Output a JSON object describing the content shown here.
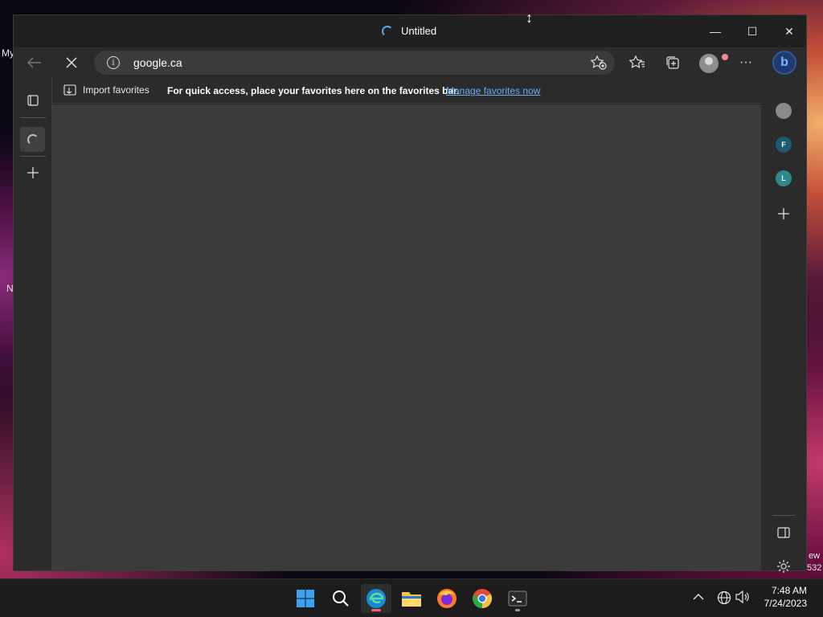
{
  "desktop": {
    "fragment_my": "My",
    "fragment_n": "N",
    "fragment_ew": "ew",
    "fragment_532": "532"
  },
  "window": {
    "tab_title": "Untitled",
    "controls": {
      "minimize": "—",
      "maximize": "☐",
      "close": "✕"
    }
  },
  "toolbar": {
    "address": "google.ca",
    "info_icon": "i"
  },
  "favorites_bar": {
    "import_label": "Import favorites",
    "message": "For quick access, place your favorites here on the favorites bar.",
    "manage_link": "Manage favorites now"
  },
  "right_rail": {
    "items": [
      {
        "label": "",
        "color": "#8a8a8a"
      },
      {
        "label": "F",
        "color": "#1e5a6e"
      },
      {
        "label": "L",
        "color": "#2e8a8a"
      }
    ]
  },
  "taskbar": {
    "time": "7:48 AM",
    "date": "7/24/2023"
  }
}
